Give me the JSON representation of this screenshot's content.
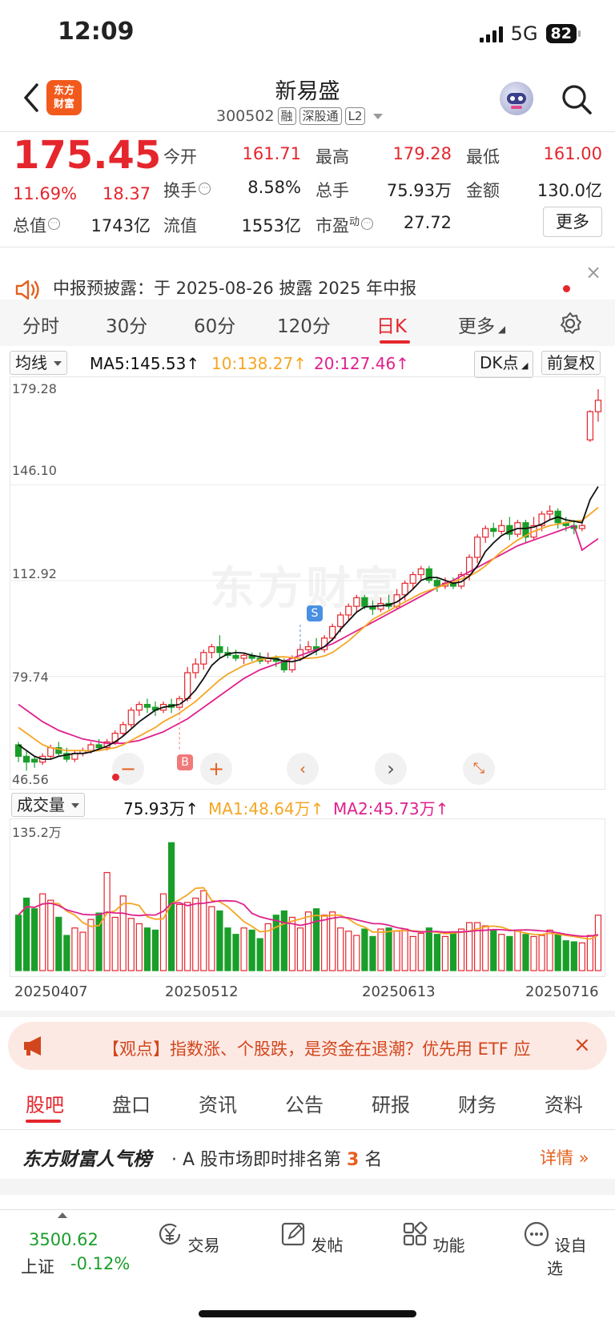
{
  "status": {
    "time": "12:09",
    "network": "5G",
    "battery": "82"
  },
  "header": {
    "logo_line1": "东方",
    "logo_line2": "财富",
    "title": "新易盛",
    "code": "300502",
    "tags": [
      "融",
      "深股通",
      "L2"
    ]
  },
  "quote": {
    "price": "175.45",
    "change_pct": "11.69%",
    "change": "18.37",
    "rows": [
      [
        {
          "label": "今开",
          "value": "161.71",
          "color": "red"
        },
        {
          "label": "最高",
          "value": "179.28",
          "color": "red"
        },
        {
          "label": "最低",
          "value": "161.00",
          "color": "red"
        }
      ],
      [
        {
          "label": "换手",
          "value": "8.58%",
          "color": "dark"
        },
        {
          "label": "总手",
          "value": "75.93万",
          "color": "dark"
        },
        {
          "label": "金额",
          "value": "130.0亿",
          "color": "dark"
        }
      ],
      [
        {
          "label": "总值",
          "value": "1743亿",
          "color": "dark"
        },
        {
          "label": "流值",
          "value": "1553亿",
          "color": "dark"
        },
        {
          "label": "市盈",
          "value": "27.72",
          "color": "dark"
        }
      ]
    ],
    "pe_superscript": "动",
    "more_label": "更多"
  },
  "notice": {
    "text": "中报预披露：于 2025-08-26 披露 2025 年中报",
    "close": "×"
  },
  "period_tabs": [
    {
      "label": "分时",
      "active": false
    },
    {
      "label": "30分",
      "active": false
    },
    {
      "label": "60分",
      "active": false
    },
    {
      "label": "120分",
      "active": false
    },
    {
      "label": "日K",
      "active": true
    },
    {
      "label": "更多",
      "active": false
    }
  ],
  "ma_legend": {
    "selector": "均线",
    "ma5": "MA5:145.53↑",
    "ma10": "10:138.27↑",
    "ma20": "20:127.46↑",
    "dk": "DK点",
    "adjust": "前复权"
  },
  "colors": {
    "up": "#e5262d",
    "down": "#1a9e2a",
    "ma5": "#111111",
    "ma10": "#f5a623",
    "ma20": "#e0208c",
    "brand": "#f25a1c"
  },
  "markers": {
    "s_label": "S",
    "b_label": "B"
  },
  "volume_legend": {
    "selector": "成交量",
    "vol": "75.93万↑",
    "ma1": "MA1:48.64万↑",
    "ma2": "MA2:45.73万↑"
  },
  "chart_data": {
    "type": "candlestick",
    "y_ticks": [
      "179.28",
      "146.10",
      "112.92",
      "79.74",
      "46.56"
    ],
    "ylim": [
      46.56,
      179.28
    ],
    "date_labels": [
      "20250407",
      "20250512",
      "20250613",
      "20250716"
    ],
    "candles": [
      [
        56,
        52,
        57,
        50
      ],
      [
        52,
        50,
        54,
        47
      ],
      [
        51,
        50,
        52,
        48
      ],
      [
        50,
        52,
        53,
        49
      ],
      [
        52,
        55,
        56,
        51
      ],
      [
        55,
        53,
        57,
        52
      ],
      [
        53,
        51,
        55,
        50
      ],
      [
        51,
        53,
        54,
        50
      ],
      [
        53,
        54,
        55,
        52
      ],
      [
        54,
        56,
        57,
        53
      ],
      [
        56,
        55,
        58,
        54
      ],
      [
        55,
        57,
        58,
        54
      ],
      [
        57,
        60,
        61,
        56
      ],
      [
        60,
        63,
        64,
        59
      ],
      [
        63,
        68,
        69,
        62
      ],
      [
        68,
        70,
        71,
        66
      ],
      [
        70,
        69,
        72,
        67
      ],
      [
        69,
        68,
        71,
        66
      ],
      [
        68,
        70,
        71,
        67
      ],
      [
        70,
        69,
        72,
        67
      ],
      [
        69,
        72,
        73,
        68
      ],
      [
        72,
        81,
        83,
        71
      ],
      [
        81,
        84,
        86,
        79
      ],
      [
        84,
        88,
        89,
        82
      ],
      [
        88,
        90,
        91,
        86
      ],
      [
        90,
        88,
        94,
        86
      ],
      [
        88,
        87,
        90,
        86
      ],
      [
        87,
        86,
        89,
        85
      ],
      [
        86,
        87,
        88,
        84
      ],
      [
        87,
        86,
        88,
        85
      ],
      [
        86,
        85,
        88,
        84
      ],
      [
        85,
        86,
        88,
        84
      ],
      [
        86,
        85,
        87,
        83
      ],
      [
        85,
        82,
        86,
        81
      ],
      [
        82,
        86,
        87,
        81
      ],
      [
        86,
        89,
        91,
        85
      ],
      [
        89,
        90,
        92,
        88
      ],
      [
        90,
        89,
        93,
        87
      ],
      [
        89,
        93,
        94,
        88
      ],
      [
        93,
        97,
        98,
        92
      ],
      [
        97,
        101,
        102,
        95
      ],
      [
        101,
        104,
        105,
        99
      ],
      [
        104,
        107,
        108,
        102
      ],
      [
        107,
        104,
        108,
        103
      ],
      [
        104,
        103,
        106,
        101
      ],
      [
        103,
        105,
        107,
        102
      ],
      [
        105,
        104,
        108,
        103
      ],
      [
        104,
        108,
        110,
        103
      ],
      [
        108,
        112,
        113,
        106
      ],
      [
        112,
        115,
        116,
        110
      ],
      [
        115,
        117,
        118,
        113
      ],
      [
        117,
        113,
        118,
        112
      ],
      [
        113,
        111,
        114,
        109
      ],
      [
        111,
        112,
        114,
        110
      ],
      [
        112,
        111,
        114,
        110
      ],
      [
        111,
        115,
        116,
        110
      ],
      [
        115,
        121,
        122,
        113
      ],
      [
        121,
        128,
        129,
        119
      ],
      [
        128,
        131,
        132,
        126
      ],
      [
        131,
        130,
        133,
        128
      ],
      [
        130,
        132,
        134,
        129
      ],
      [
        132,
        129,
        135,
        127
      ],
      [
        129,
        133,
        134,
        128
      ],
      [
        133,
        128,
        134,
        126
      ],
      [
        128,
        132,
        135,
        127
      ],
      [
        132,
        136,
        137,
        130
      ],
      [
        136,
        137,
        139,
        134
      ],
      [
        137,
        133,
        138,
        131
      ],
      [
        133,
        132,
        135,
        130
      ],
      [
        132,
        131,
        134,
        129
      ],
      [
        131,
        132,
        134,
        130
      ],
      [
        161.71,
        171.5,
        172,
        161
      ],
      [
        171.5,
        175.45,
        179.28,
        168
      ]
    ],
    "ma5": [
      56,
      54,
      52,
      51,
      51,
      52,
      52.5,
      53,
      53,
      53.5,
      54.5,
      55.5,
      57,
      59,
      61.5,
      64,
      66,
      68,
      69,
      69.5,
      70,
      72,
      75,
      79,
      83.5,
      86,
      87.5,
      88,
      87.8,
      87,
      86.5,
      86,
      85.8,
      85,
      84.8,
      85.5,
      87,
      88.5,
      90,
      92.5,
      96,
      99,
      102,
      103.8,
      104,
      104.2,
      104.5,
      105.5,
      107.5,
      110,
      113,
      114,
      114,
      113,
      112,
      112.5,
      114.5,
      118,
      123,
      126,
      128.5,
      130,
      131,
      131,
      131.5,
      132.5,
      134,
      135,
      134,
      133.5,
      133,
      141,
      145.53
    ],
    "ma10": [
      62,
      60,
      58,
      56,
      55,
      54.5,
      54,
      54,
      54,
      53.8,
      54,
      54.5,
      55,
      56,
      57.5,
      59,
      60.5,
      62,
      64,
      65.5,
      67,
      69,
      71,
      73.5,
      76,
      78.5,
      80.5,
      82,
      83.5,
      84.5,
      85.5,
      86,
      86.5,
      86.5,
      86.2,
      86,
      86,
      86.2,
      86.8,
      88,
      90,
      92,
      94.5,
      97,
      99.5,
      101,
      102.5,
      104,
      105.5,
      107,
      108.5,
      109.5,
      110.5,
      111.5,
      112.5,
      113.5,
      114.5,
      116,
      118,
      120.5,
      123,
      125,
      127,
      128.5,
      130,
      131,
      132,
      132.5,
      133,
      133.5,
      133.8,
      136,
      138.27
    ],
    "ma20": [
      70,
      68,
      66,
      64,
      62.5,
      61,
      60,
      59,
      58,
      57.5,
      57,
      56.5,
      56.5,
      56.5,
      57,
      57.5,
      58.5,
      59.5,
      60.5,
      62,
      63.5,
      65,
      67,
      69,
      71,
      73,
      75,
      77,
      79,
      80.5,
      82,
      83,
      84,
      85,
      86,
      87,
      88,
      89,
      90,
      91,
      92.5,
      94,
      95.5,
      97,
      98.5,
      100,
      101.5,
      103,
      104.5,
      106,
      107.5,
      109,
      110.5,
      112,
      113,
      114.5,
      116,
      117.5,
      119,
      120.5,
      122,
      123.5,
      125,
      126,
      127,
      128,
      129,
      130,
      131,
      132,
      123.5,
      125.5,
      127.46
    ],
    "volumes": [
      52,
      68,
      58,
      72,
      66,
      50,
      33,
      40,
      36,
      48,
      54,
      92,
      50,
      70,
      49,
      44,
      40,
      38,
      72,
      120,
      62,
      64,
      68,
      75,
      60,
      56,
      40,
      34,
      40,
      38,
      30,
      44,
      52,
      56,
      50,
      40,
      55,
      58,
      52,
      55,
      40,
      37,
      33,
      39,
      32,
      39,
      40,
      37,
      39,
      32,
      35,
      40,
      34,
      32,
      35,
      39,
      45,
      45,
      42,
      38,
      34,
      32,
      38,
      34,
      32,
      33,
      38,
      34,
      28,
      27,
      26,
      33,
      52
    ]
  },
  "volume_axis_label": "135.2万",
  "news": {
    "text": "【观点】指数涨、个股跌，是资金在退潮？优先用 ETF 应",
    "close": "×"
  },
  "section_tabs": [
    {
      "label": "股吧",
      "active": true
    },
    {
      "label": "盘口",
      "active": false
    },
    {
      "label": "资讯",
      "active": false
    },
    {
      "label": "公告",
      "active": false
    },
    {
      "label": "研报",
      "active": false
    },
    {
      "label": "财务",
      "active": false
    },
    {
      "label": "资料",
      "active": false
    }
  ],
  "popularity": {
    "brand": "东方财富人气榜",
    "text_prefix": "· A 股市场即时排名第",
    "rank": "3",
    "text_suffix": "名",
    "detail": "详情"
  },
  "bottom_bar": {
    "index_value": "3500.62",
    "index_name": "上证",
    "index_change": "-0.12%",
    "buttons": [
      {
        "label": "交易",
        "icon": "yen-cycle-icon"
      },
      {
        "label": "发帖",
        "icon": "edit-icon"
      },
      {
        "label": "功能",
        "icon": "grid-icon"
      },
      {
        "label": "设自选",
        "icon": "more-circle-icon"
      }
    ]
  }
}
